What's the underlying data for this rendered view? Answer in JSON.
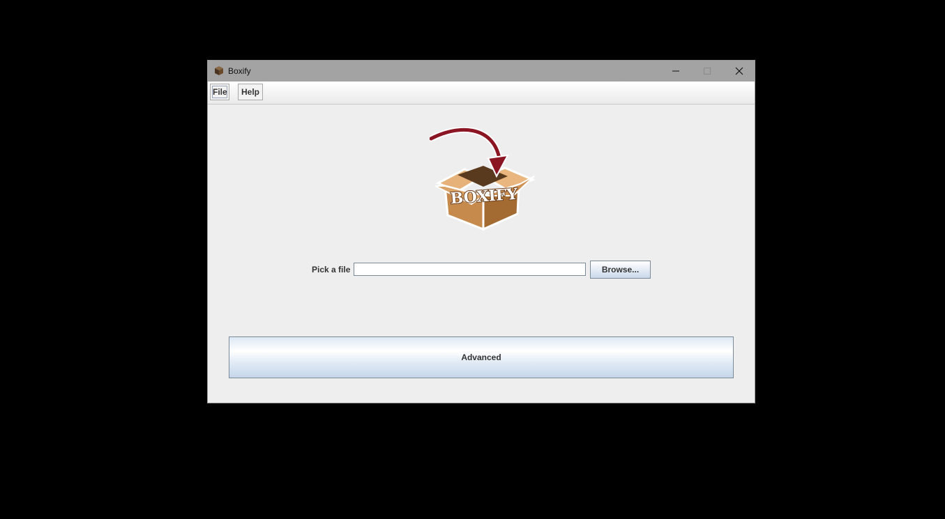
{
  "window": {
    "title": "Boxify"
  },
  "menubar": {
    "file_label": "File",
    "help_label": "Help"
  },
  "logo": {
    "text": "BOXIFY"
  },
  "file_picker": {
    "label": "Pick a file",
    "value": "",
    "browse_label": "Browse..."
  },
  "advanced": {
    "label": "Advanced"
  },
  "icons": {
    "app": "box-icon",
    "minimize": "minimize-icon",
    "maximize": "maximize-icon",
    "close": "close-icon"
  },
  "colors": {
    "titlebar": "#a3a3a3",
    "window_bg": "#eeeeee",
    "arrow": "#8b1523",
    "box": "#b9834a",
    "button_accent": "#c9d8ea"
  }
}
